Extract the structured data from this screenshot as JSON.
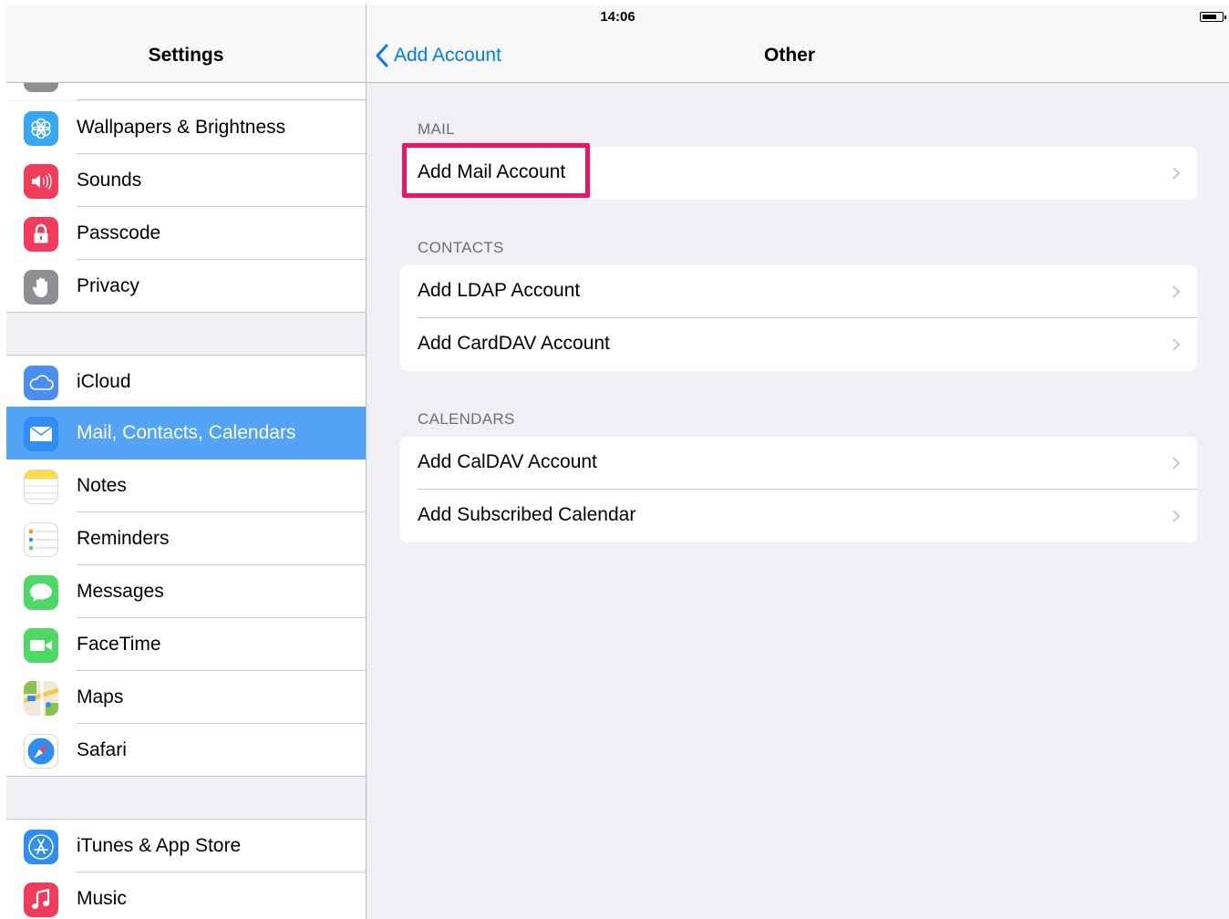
{
  "status_bar": {
    "time": "14:06",
    "left_icons": [
      "airplane-icon",
      "wifi-icon"
    ],
    "battery": "battery-icon"
  },
  "master": {
    "title": "Settings",
    "items": [
      {
        "label": "Wallpapers & Brightness",
        "icon": "wallpaper-icon",
        "color": "#36a8f3"
      },
      {
        "label": "Sounds",
        "icon": "speaker-icon",
        "color": "#f23a5a"
      },
      {
        "label": "Passcode",
        "icon": "lock-icon",
        "color": "#f23a5a"
      },
      {
        "label": "Privacy",
        "icon": "hand-icon",
        "color": "#8e8e93"
      },
      {
        "label": "iCloud",
        "icon": "cloud-icon",
        "color": "#4a8ef2"
      },
      {
        "label": "Mail, Contacts, Calendars",
        "icon": "mail-icon",
        "color": "#2f8ef5",
        "selected": true
      },
      {
        "label": "Notes",
        "icon": "notes-icon",
        "color": "#fedc4a"
      },
      {
        "label": "Reminders",
        "icon": "reminders-icon",
        "color": "#ffffff"
      },
      {
        "label": "Messages",
        "icon": "messages-icon",
        "color": "#4cd964"
      },
      {
        "label": "FaceTime",
        "icon": "facetime-icon",
        "color": "#4cd964"
      },
      {
        "label": "Maps",
        "icon": "maps-icon",
        "color": "#8bc34a"
      },
      {
        "label": "Safari",
        "icon": "safari-icon",
        "color": "#2f8ef5"
      },
      {
        "label": "iTunes & App Store",
        "icon": "app-store-icon",
        "color": "#2f8ef5"
      },
      {
        "label": "Music",
        "icon": "music-icon",
        "color": "#f23a5a"
      }
    ]
  },
  "detail": {
    "back_label": "Add Account",
    "title": "Other",
    "sections": [
      {
        "header": "MAIL",
        "cells": [
          "Add Mail Account"
        ]
      },
      {
        "header": "CONTACTS",
        "cells": [
          "Add LDAP Account",
          "Add CardDAV Account"
        ]
      },
      {
        "header": "CALENDARS",
        "cells": [
          "Add CalDAV Account",
          "Add Subscribed Calendar"
        ]
      }
    ],
    "highlight_color": "#f2125f"
  },
  "colors": {
    "accent": "#007aff",
    "selected_row": "#53a3f7"
  }
}
